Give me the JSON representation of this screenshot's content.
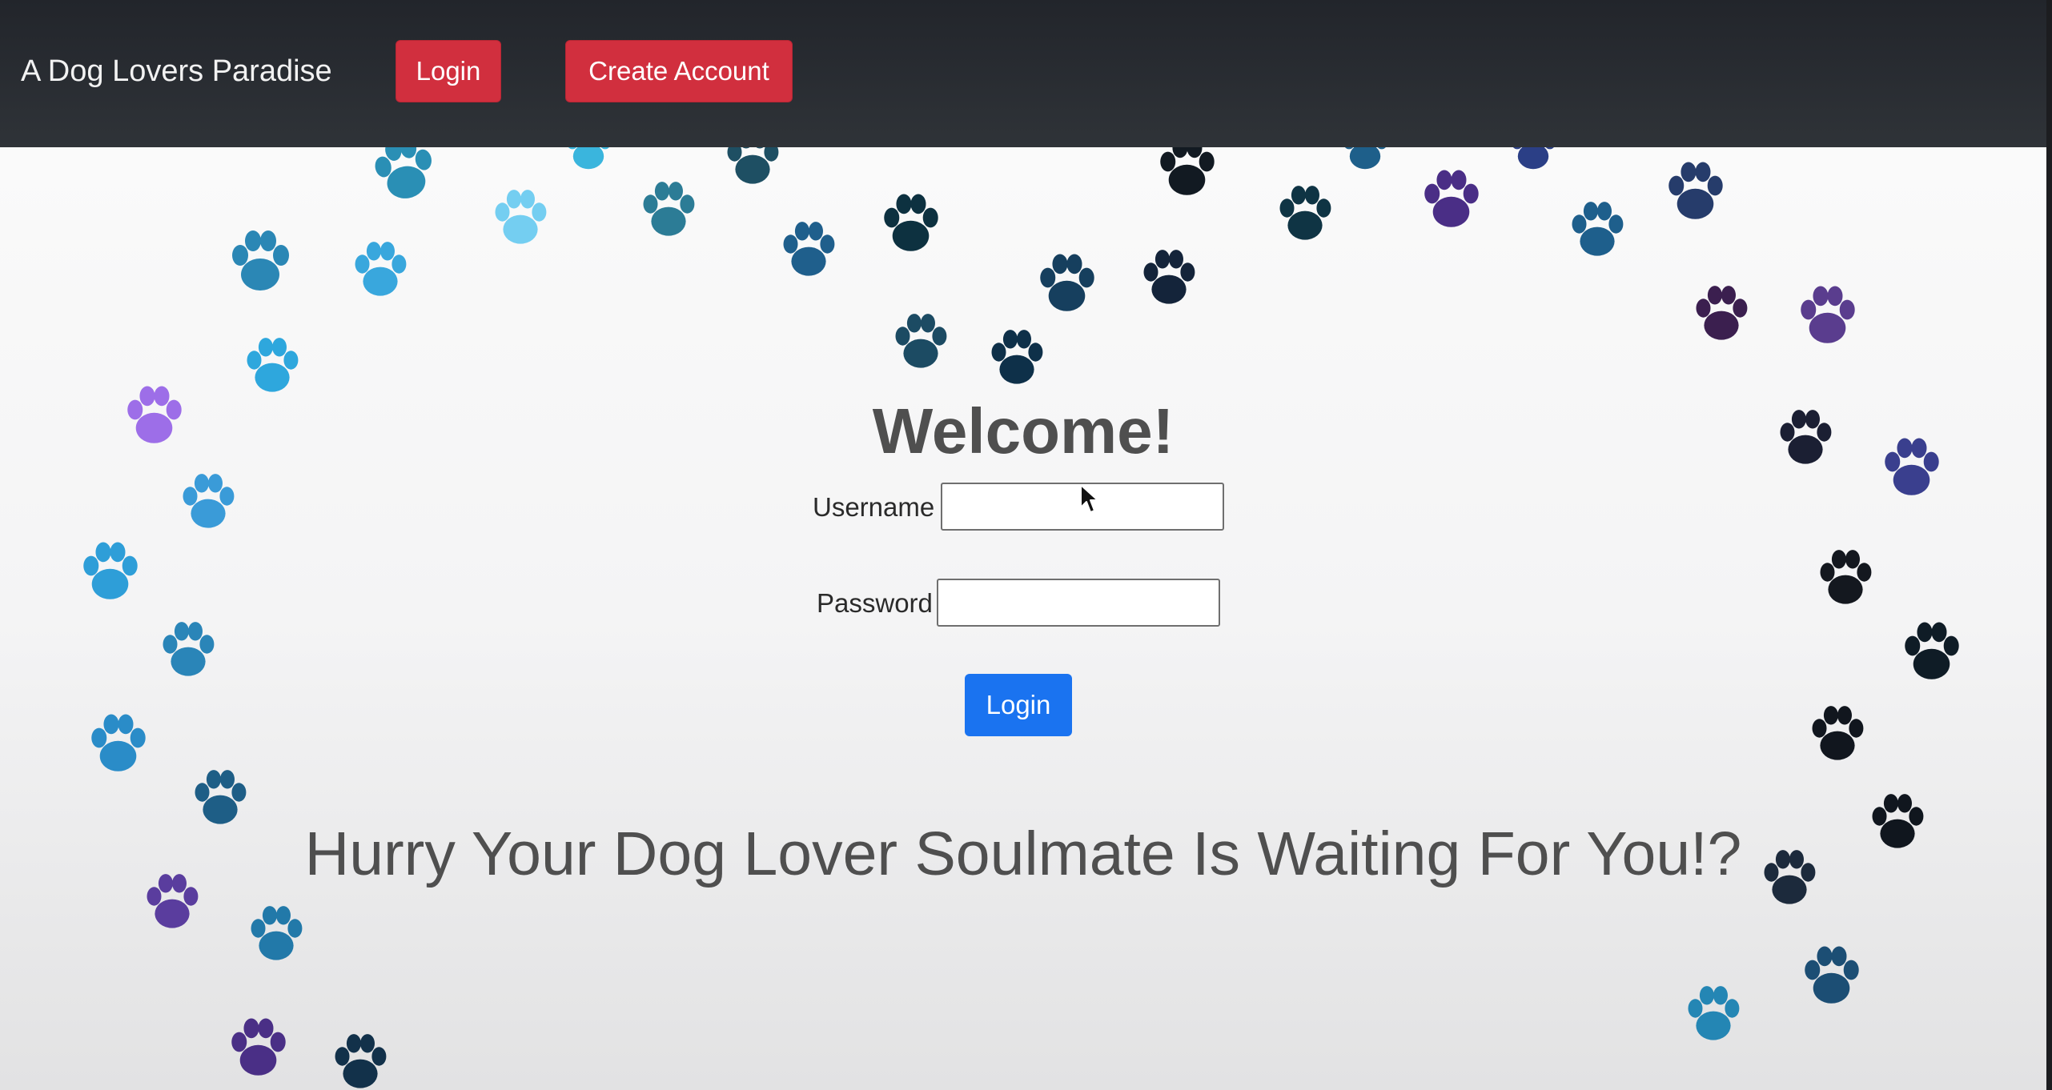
{
  "navbar": {
    "brand": "A Dog Lovers Paradise",
    "login_label": "Login",
    "create_account_label": "Create Account"
  },
  "main": {
    "heading": "Welcome!",
    "username_label": "Username",
    "username_value": "",
    "password_label": "Password",
    "password_value": "",
    "submit_label": "Login",
    "tagline": "Hurry Your Dog Lover Soulmate Is Waiting For You!?"
  },
  "colors": {
    "navbar": "#2b2e33",
    "nav_button": "#d12f3e",
    "primary_button": "#1a73f0",
    "heading_text": "#4f4f4f"
  },
  "icons": {
    "background": "paw-print-icon",
    "cursor": "mouse-cursor-icon"
  }
}
